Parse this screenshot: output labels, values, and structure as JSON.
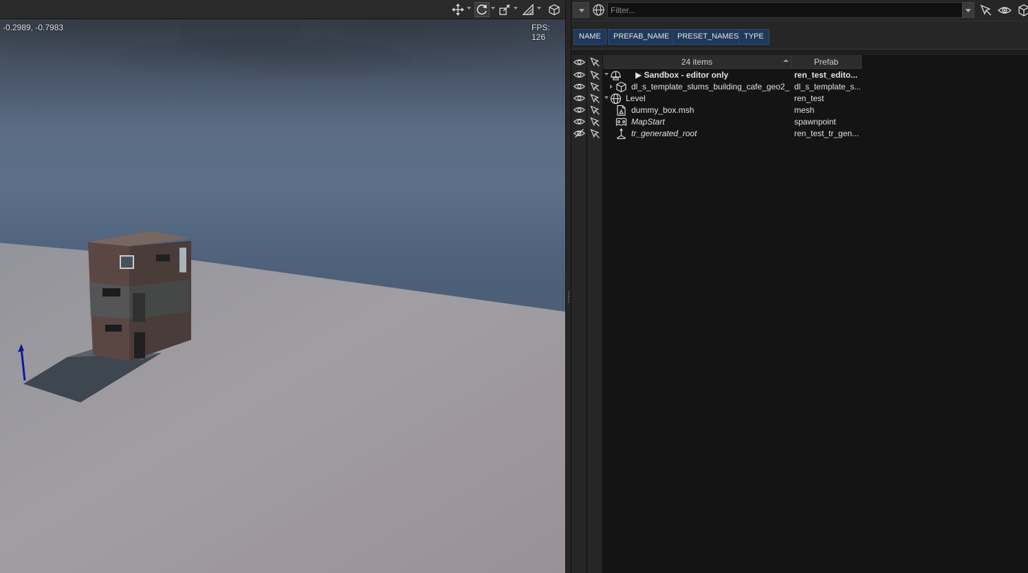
{
  "viewport": {
    "coords": "-0.2989, -0.7983",
    "fps": "FPS: 126",
    "toolbar": {
      "icons": [
        "move-icon",
        "rotate-icon",
        "scale-icon",
        "snap-icon",
        "cube-icon"
      ]
    }
  },
  "outliner": {
    "filter": {
      "placeholder": "Filter..."
    },
    "toolbar_icons": [
      "select-arrow-icon",
      "eye-icon",
      "cube-icon"
    ],
    "tags": [
      "NAME",
      "PREFAB_NAME",
      "PRESET_NAMES",
      "TYPE"
    ],
    "header": {
      "count": "24 items",
      "prefab": "Prefab"
    },
    "rows": [
      {
        "name": "▶ Sandbox - editor only",
        "prefab": "ren_test_edito...",
        "icon": "helmet-icon",
        "bold": true,
        "italic": false,
        "expander": "open",
        "visible": true
      },
      {
        "name": "dl_s_template_slums_building_cafe_geo2_...",
        "prefab": "dl_s_template_s...",
        "icon": "cube-icon",
        "bold": false,
        "italic": false,
        "expander": "closed",
        "visible": true
      },
      {
        "name": "Level",
        "prefab": "ren_test",
        "icon": "globe-icon",
        "bold": false,
        "italic": false,
        "expander": "open",
        "visible": true
      },
      {
        "name": "dummy_box.msh",
        "prefab": "mesh",
        "icon": "mesh-file-icon",
        "bold": false,
        "italic": false,
        "expander": "none",
        "visible": true
      },
      {
        "name": "MapStart",
        "prefab": "spawnpoint",
        "icon": "spawnpoint-icon",
        "bold": false,
        "italic": true,
        "expander": "none",
        "visible": true
      },
      {
        "name": "tr_generated_root",
        "prefab": "ren_test_tr_gen...",
        "icon": "transform-root-icon",
        "bold": false,
        "italic": true,
        "expander": "none",
        "visible": false
      }
    ]
  }
}
